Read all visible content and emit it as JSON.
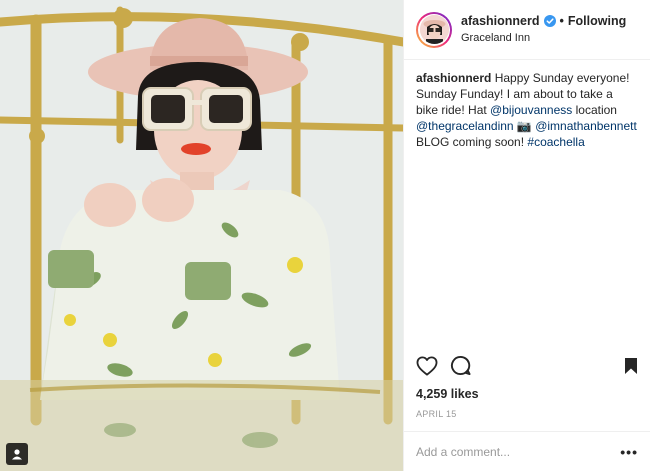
{
  "post": {
    "username": "afashionnerd",
    "separator": "•",
    "follow_label": "Following",
    "location": "Graceland Inn",
    "caption": {
      "username": "afashionnerd",
      "text_1": " Happy Sunday everyone! Sunday Funday! I am about to take a bike ride! Hat ",
      "mention_1": "@bijouvanness",
      "text_2": " location ",
      "mention_2": "@thegracelandinn",
      "text_3": " 📷 ",
      "mention_3": "@imnathanbennett",
      "text_4": " BLOG coming soon! ",
      "hashtag": "#coachella"
    },
    "likes": "4,259 likes",
    "date": "APRIL 15",
    "comment_placeholder": "Add a comment...",
    "more_label": "•••"
  },
  "icons": {
    "verified": "verified-badge-icon",
    "like": "heart-icon",
    "comment": "comment-bubble-icon",
    "save": "bookmark-icon",
    "tag": "person-tag-icon"
  },
  "colors": {
    "verified": "#3897f0",
    "link": "#003569",
    "text": "#262626",
    "muted": "#999999",
    "border": "#efefef"
  }
}
